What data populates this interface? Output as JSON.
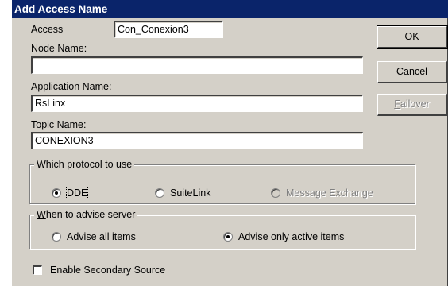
{
  "dialog": {
    "title": "Add Access Name",
    "access_label": "Access",
    "access_value": "Con_Conexion3",
    "node_label": "Node Name:",
    "node_value": "",
    "app_label_u": "A",
    "app_label_rest": "pplication Name:",
    "app_value": "RsLinx",
    "topic_label_u": "T",
    "topic_label_rest": "opic Name:",
    "topic_value": "CONEXION3"
  },
  "buttons": {
    "ok": "OK",
    "cancel": "Cancel",
    "failover_u": "F",
    "failover_rest": "ailover"
  },
  "protocol": {
    "legend": "Which protocol to use",
    "options": [
      {
        "label": "DDE",
        "selected": true
      },
      {
        "label": "SuiteLink",
        "selected": false
      },
      {
        "label": "Message Exchange",
        "selected": false,
        "disabled": true
      }
    ]
  },
  "advise": {
    "legend_u": "W",
    "legend_rest": "hen to advise server",
    "options": [
      {
        "label": "Advise all items",
        "selected": false
      },
      {
        "label": "Advise only active items",
        "selected": true
      }
    ]
  },
  "secondary": {
    "label": "Enable Secondary Source",
    "checked": false
  },
  "colors": {
    "titlebar": "#0a246a",
    "face": "#d4d0c8"
  }
}
